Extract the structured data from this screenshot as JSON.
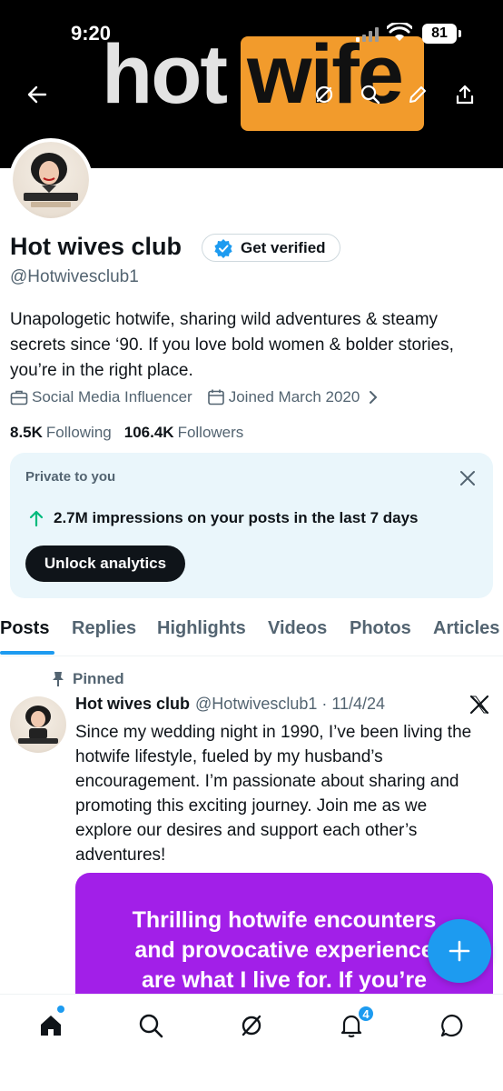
{
  "status_bar": {
    "time": "9:20",
    "battery": "81"
  },
  "banner": {
    "text_part1": "hot",
    "text_part2": "wife"
  },
  "profile": {
    "name": "Hot wives club",
    "verify_label": "Get verified",
    "handle": "@Hotwivesclub1",
    "bio": "Unapologetic hotwife, sharing wild adventures & steamy secrets since ‘90. If you love bold women & bolder stories, you’re in the right place.",
    "category": "Social Media Influencer",
    "joined": "Joined March 2020",
    "following_count": "8.5K",
    "following_label": "Following",
    "followers_count": "106.4K",
    "followers_label": "Followers"
  },
  "analytics_card": {
    "title": "Private to you",
    "impressions": "2.7M impressions on your posts in the last 7 days",
    "button": "Unlock analytics"
  },
  "tabs": [
    "Posts",
    "Replies",
    "Highlights",
    "Videos",
    "Photos",
    "Articles"
  ],
  "post": {
    "pinned_label": "Pinned",
    "author": "Hot wives club",
    "handle_date": "@Hotwivesclub1 · 11/4/24",
    "text": "Since my wedding night in 1990, I’ve been living the hotwife lifestyle, fueled by my husband’s encouragement. I’m passionate about sharing and promoting this exciting journey. Join me as we explore our desires and support each other’s adventures!",
    "image_lines": [
      "Thrilling hotwife encounters",
      "and provocative experience",
      "are what I live for. If you’re"
    ]
  },
  "bottom_nav": {
    "notification_badge": "4"
  },
  "colors": {
    "accent": "#1d9bf0",
    "image_bg": "#a21fe8",
    "card_bg": "#eaf6fb",
    "banner_box": "#f29b2c"
  }
}
